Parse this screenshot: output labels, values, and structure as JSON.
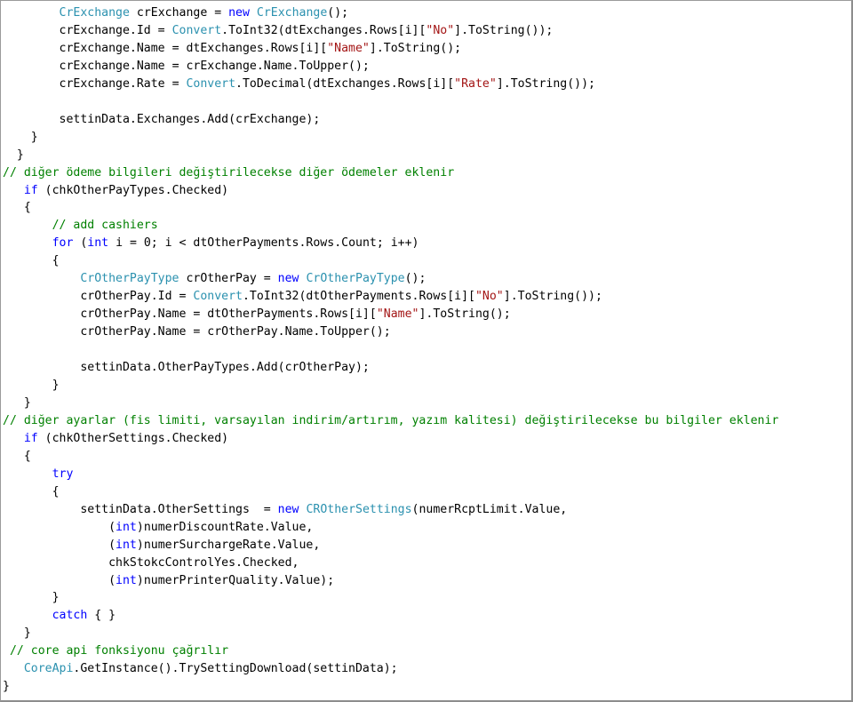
{
  "document": {
    "kind": "code-listing",
    "language": "C#",
    "background_color": "#FFFFFF",
    "border_color": "#9A9A9A"
  },
  "syntax_colors": {
    "type": "#2B91AF",
    "keyword": "#0000FF",
    "string": "#A31515",
    "comment": "#008000",
    "plain": "#000000"
  },
  "code": {
    "lines": [
      {
        "id": "line-1",
        "tokens": [
          {
            "t": "plain",
            "s": "        "
          },
          {
            "t": "type",
            "s": "CrExchange"
          },
          {
            "t": "plain",
            "s": " crExchange = "
          },
          {
            "t": "keyword",
            "s": "new"
          },
          {
            "t": "plain",
            "s": " "
          },
          {
            "t": "type",
            "s": "CrExchange"
          },
          {
            "t": "plain",
            "s": "();"
          }
        ]
      },
      {
        "id": "line-2",
        "tokens": [
          {
            "t": "plain",
            "s": "        crExchange.Id = "
          },
          {
            "t": "type",
            "s": "Convert"
          },
          {
            "t": "plain",
            "s": ".ToInt32(dtExchanges.Rows[i]["
          },
          {
            "t": "string",
            "s": "\"No\""
          },
          {
            "t": "plain",
            "s": "].ToString());"
          }
        ]
      },
      {
        "id": "line-3",
        "tokens": [
          {
            "t": "plain",
            "s": "        crExchange.Name = dtExchanges.Rows[i]["
          },
          {
            "t": "string",
            "s": "\"Name\""
          },
          {
            "t": "plain",
            "s": "].ToString();"
          }
        ]
      },
      {
        "id": "line-4",
        "tokens": [
          {
            "t": "plain",
            "s": "        crExchange.Name = crExchange.Name.ToUpper();"
          }
        ]
      },
      {
        "id": "line-5",
        "tokens": [
          {
            "t": "plain",
            "s": "        crExchange.Rate = "
          },
          {
            "t": "type",
            "s": "Convert"
          },
          {
            "t": "plain",
            "s": ".ToDecimal(dtExchanges.Rows[i]["
          },
          {
            "t": "string",
            "s": "\"Rate\""
          },
          {
            "t": "plain",
            "s": "].ToString());"
          }
        ]
      },
      {
        "id": "line-6",
        "tokens": [
          {
            "t": "plain",
            "s": ""
          }
        ]
      },
      {
        "id": "line-7",
        "tokens": [
          {
            "t": "plain",
            "s": "        settinData.Exchanges.Add(crExchange);"
          }
        ]
      },
      {
        "id": "line-8",
        "tokens": [
          {
            "t": "plain",
            "s": "    }"
          }
        ]
      },
      {
        "id": "line-9",
        "tokens": [
          {
            "t": "plain",
            "s": "  }"
          }
        ]
      },
      {
        "id": "line-10",
        "tokens": [
          {
            "t": "comment",
            "s": "// diğer ödeme bilgileri değiştirilecekse diğer ödemeler eklenir"
          }
        ]
      },
      {
        "id": "line-11",
        "tokens": [
          {
            "t": "plain",
            "s": "   "
          },
          {
            "t": "keyword",
            "s": "if"
          },
          {
            "t": "plain",
            "s": " (chkOtherPayTypes.Checked)"
          }
        ]
      },
      {
        "id": "line-12",
        "tokens": [
          {
            "t": "plain",
            "s": "   {"
          }
        ]
      },
      {
        "id": "line-13",
        "tokens": [
          {
            "t": "plain",
            "s": "       "
          },
          {
            "t": "comment",
            "s": "// add cashiers"
          }
        ]
      },
      {
        "id": "line-14",
        "tokens": [
          {
            "t": "plain",
            "s": "       "
          },
          {
            "t": "keyword",
            "s": "for"
          },
          {
            "t": "plain",
            "s": " ("
          },
          {
            "t": "keyword",
            "s": "int"
          },
          {
            "t": "plain",
            "s": " i = 0; i < dtOtherPayments.Rows.Count; i++)"
          }
        ]
      },
      {
        "id": "line-15",
        "tokens": [
          {
            "t": "plain",
            "s": "       {"
          }
        ]
      },
      {
        "id": "line-16",
        "tokens": [
          {
            "t": "plain",
            "s": "           "
          },
          {
            "t": "type",
            "s": "CrOtherPayType"
          },
          {
            "t": "plain",
            "s": " crOtherPay = "
          },
          {
            "t": "keyword",
            "s": "new"
          },
          {
            "t": "plain",
            "s": " "
          },
          {
            "t": "type",
            "s": "CrOtherPayType"
          },
          {
            "t": "plain",
            "s": "();"
          }
        ]
      },
      {
        "id": "line-17",
        "tokens": [
          {
            "t": "plain",
            "s": "           crOtherPay.Id = "
          },
          {
            "t": "type",
            "s": "Convert"
          },
          {
            "t": "plain",
            "s": ".ToInt32(dtOtherPayments.Rows[i]["
          },
          {
            "t": "string",
            "s": "\"No\""
          },
          {
            "t": "plain",
            "s": "].ToString());"
          }
        ]
      },
      {
        "id": "line-18",
        "tokens": [
          {
            "t": "plain",
            "s": "           crOtherPay.Name = dtOtherPayments.Rows[i]["
          },
          {
            "t": "string",
            "s": "\"Name\""
          },
          {
            "t": "plain",
            "s": "].ToString();"
          }
        ]
      },
      {
        "id": "line-19",
        "tokens": [
          {
            "t": "plain",
            "s": "           crOtherPay.Name = crOtherPay.Name.ToUpper();"
          }
        ]
      },
      {
        "id": "line-20",
        "tokens": [
          {
            "t": "plain",
            "s": ""
          }
        ]
      },
      {
        "id": "line-21",
        "tokens": [
          {
            "t": "plain",
            "s": "           settinData.OtherPayTypes.Add(crOtherPay);"
          }
        ]
      },
      {
        "id": "line-22",
        "tokens": [
          {
            "t": "plain",
            "s": "       }"
          }
        ]
      },
      {
        "id": "line-23",
        "tokens": [
          {
            "t": "plain",
            "s": "   }"
          }
        ]
      },
      {
        "id": "line-24",
        "tokens": [
          {
            "t": "comment",
            "s": "// diğer ayarlar (fis limiti, varsayılan indirim/artırım, yazım kalitesi) değiştirilecekse bu bilgiler eklenir"
          }
        ]
      },
      {
        "id": "line-25",
        "tokens": [
          {
            "t": "plain",
            "s": "   "
          },
          {
            "t": "keyword",
            "s": "if"
          },
          {
            "t": "plain",
            "s": " (chkOtherSettings.Checked)"
          }
        ]
      },
      {
        "id": "line-26",
        "tokens": [
          {
            "t": "plain",
            "s": "   {"
          }
        ]
      },
      {
        "id": "line-27",
        "tokens": [
          {
            "t": "plain",
            "s": "       "
          },
          {
            "t": "keyword",
            "s": "try"
          }
        ]
      },
      {
        "id": "line-28",
        "tokens": [
          {
            "t": "plain",
            "s": "       {"
          }
        ]
      },
      {
        "id": "line-29",
        "tokens": [
          {
            "t": "plain",
            "s": "           settinData.OtherSettings  = "
          },
          {
            "t": "keyword",
            "s": "new"
          },
          {
            "t": "plain",
            "s": " "
          },
          {
            "t": "type",
            "s": "CROtherSettings"
          },
          {
            "t": "plain",
            "s": "(numerRcptLimit.Value,"
          }
        ]
      },
      {
        "id": "line-30",
        "tokens": [
          {
            "t": "plain",
            "s": "               ("
          },
          {
            "t": "keyword",
            "s": "int"
          },
          {
            "t": "plain",
            "s": ")numerDiscountRate.Value,"
          }
        ]
      },
      {
        "id": "line-31",
        "tokens": [
          {
            "t": "plain",
            "s": "               ("
          },
          {
            "t": "keyword",
            "s": "int"
          },
          {
            "t": "plain",
            "s": ")numerSurchargeRate.Value,"
          }
        ]
      },
      {
        "id": "line-32",
        "tokens": [
          {
            "t": "plain",
            "s": "               chkStokcControlYes.Checked,"
          }
        ]
      },
      {
        "id": "line-33",
        "tokens": [
          {
            "t": "plain",
            "s": "               ("
          },
          {
            "t": "keyword",
            "s": "int"
          },
          {
            "t": "plain",
            "s": ")numerPrinterQuality.Value);"
          }
        ]
      },
      {
        "id": "line-34",
        "tokens": [
          {
            "t": "plain",
            "s": "       }"
          }
        ]
      },
      {
        "id": "line-35",
        "tokens": [
          {
            "t": "plain",
            "s": "       "
          },
          {
            "t": "keyword",
            "s": "catch"
          },
          {
            "t": "plain",
            "s": " { }"
          }
        ]
      },
      {
        "id": "line-36",
        "tokens": [
          {
            "t": "plain",
            "s": "   }"
          }
        ]
      },
      {
        "id": "line-37",
        "tokens": [
          {
            "t": "plain",
            "s": " "
          },
          {
            "t": "comment",
            "s": "// core api fonksiyonu çağrılır"
          }
        ]
      },
      {
        "id": "line-38",
        "tokens": [
          {
            "t": "plain",
            "s": "   "
          },
          {
            "t": "type",
            "s": "CoreApi"
          },
          {
            "t": "plain",
            "s": ".GetInstance().TrySettingDownload(settinData);"
          }
        ]
      },
      {
        "id": "line-39",
        "tokens": [
          {
            "t": "plain",
            "s": "}"
          }
        ]
      }
    ]
  }
}
